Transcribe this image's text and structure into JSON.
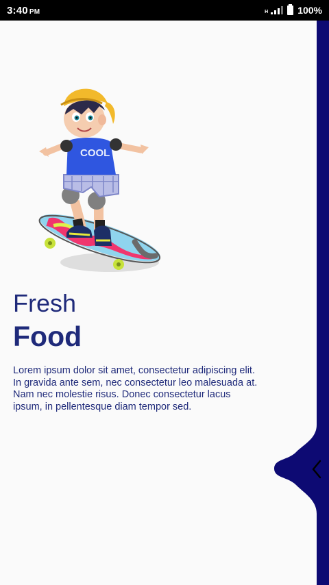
{
  "status_bar": {
    "time": "3:40",
    "ampm": "PM",
    "network_label": "H",
    "battery": "100%"
  },
  "content": {
    "title_light": "Fresh",
    "title_bold": "Food",
    "body": "Lorem ipsum dolor sit amet, consectetur adipiscing elit. In gravida ante sem, nec consectetur leo malesuada at. Nam nec molestie risus. Donec consectetur lacus ipsum, in pellentesque diam tempor sed."
  },
  "colors": {
    "panel": "#0d0a73",
    "text": "#1f2a7a",
    "background": "#fafafa"
  },
  "icons": {
    "back": "chevron-left-icon",
    "illustration": "skateboard-kid-illustration"
  }
}
